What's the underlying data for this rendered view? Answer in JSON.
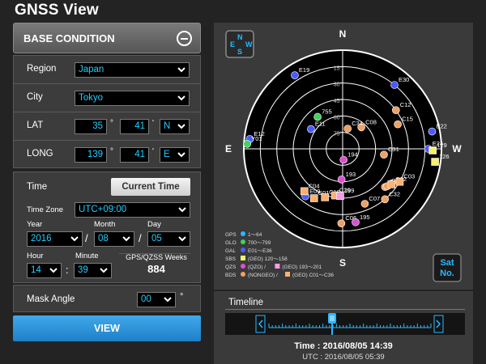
{
  "app": {
    "title": "GNSS View"
  },
  "base_condition": {
    "title": "BASE CONDITION",
    "region": {
      "label": "Region",
      "value": "Japan"
    },
    "city": {
      "label": "City",
      "value": "Tokyo"
    },
    "lat": {
      "label": "LAT",
      "deg": "35",
      "min": "41",
      "dir": "N"
    },
    "long": {
      "label": "LONG",
      "deg": "139",
      "min": "41",
      "dir": "E"
    },
    "deg_symbol": "°",
    "min_symbol": "'"
  },
  "time_section": {
    "label": "Time",
    "current_time_button": "Current Time",
    "timezone": {
      "label": "Time Zone",
      "value": "UTC+09:00"
    },
    "year": {
      "label": "Year",
      "value": "2016"
    },
    "month": {
      "label": "Month",
      "value": "08"
    },
    "day": {
      "label": "Day",
      "value": "05"
    },
    "hour": {
      "label": "Hour",
      "value": "14"
    },
    "minute": {
      "label": "Minute",
      "value": "39"
    },
    "separator_date": "/",
    "separator_time": ":",
    "weeks": {
      "label": "GPS/QZSS Weeks",
      "value": "884"
    }
  },
  "mask_angle": {
    "label": "Mask Angle",
    "value": "00",
    "unit": "°"
  },
  "view_button": "VIEW",
  "sky_plot": {
    "compass_labels": {
      "north": "N",
      "south": "S",
      "east": "E",
      "west": "W"
    },
    "compass_icon_letters": {
      "n": "N",
      "s": "S",
      "e": "E",
      "w": "W"
    },
    "sat_no_button": {
      "line1": "Sat",
      "line2": "No."
    },
    "elevation_labels": [
      "15°",
      "30°",
      "45°",
      "60°",
      "75°"
    ],
    "legend": [
      {
        "system": "GPS",
        "markers": [
          {
            "shape": "circle",
            "color": "#2bb7ff",
            "range": "1～64"
          }
        ]
      },
      {
        "system": "GLO",
        "markers": [
          {
            "shape": "circle",
            "color": "#3ed45a",
            "range": "700～799"
          }
        ]
      },
      {
        "system": "GAL",
        "markers": [
          {
            "shape": "circle",
            "color": "#4a5bff",
            "range": "E01～E36"
          }
        ]
      },
      {
        "system": "SBS",
        "markers": [
          {
            "shape": "square",
            "color": "#f8f070",
            "range": "(GEO) 120～158"
          }
        ]
      },
      {
        "system": "QZS",
        "markers": [
          {
            "shape": "circle",
            "color": "#e04ed6",
            "range": "(QZO) /"
          },
          {
            "shape": "square",
            "color": "#f59bea",
            "range": "(GEO) 193～201"
          }
        ]
      },
      {
        "system": "BDS",
        "markers": [
          {
            "shape": "circle",
            "color": "#f0a060",
            "range": "(NONGEO) /"
          },
          {
            "shape": "square",
            "color": "#ffb070",
            "range": "(GEO) C01～C36"
          }
        ]
      }
    ],
    "satellites": [
      {
        "label": "E19",
        "system": "GAL",
        "shape": "circle",
        "color": "#4a5bff",
        "elevation": 10,
        "azimuth": 327
      },
      {
        "label": "E30",
        "system": "GAL",
        "shape": "circle",
        "color": "#4a5bff",
        "elevation": 15,
        "azimuth": 39
      },
      {
        "label": "C12",
        "system": "BDS",
        "shape": "circle",
        "color": "#f0a060",
        "elevation": 30,
        "azimuth": 54
      },
      {
        "label": "C15",
        "system": "BDS",
        "shape": "circle",
        "color": "#f0a060",
        "elevation": 35,
        "azimuth": 66
      },
      {
        "label": "C08",
        "system": "BDS",
        "shape": "circle",
        "color": "#f0a060",
        "elevation": 64,
        "azimuth": 41
      },
      {
        "label": "C34",
        "system": "BDS",
        "shape": "circle",
        "color": "#f0a060",
        "elevation": 71,
        "azimuth": 14
      },
      {
        "label": "755",
        "system": "GLO",
        "shape": "circle",
        "color": "#3ed45a",
        "elevation": 53,
        "azimuth": 322
      },
      {
        "label": "E11",
        "system": "GAL",
        "shape": "circle",
        "color": "#4a5bff",
        "elevation": 56,
        "azimuth": 302
      },
      {
        "label": "E22",
        "system": "GAL",
        "shape": "circle",
        "color": "#4a5bff",
        "elevation": 7,
        "azimuth": 79
      },
      {
        "label": "E12",
        "system": "GAL",
        "shape": "circle",
        "color": "#4a5bff",
        "elevation": 5,
        "azimuth": 276
      },
      {
        "label": "Y01",
        "system": "GLO",
        "shape": "circle",
        "color": "#3ed45a",
        "elevation": 3,
        "azimuth": 273
      },
      {
        "label": "E24",
        "system": "GAL",
        "shape": "circle",
        "color": "#4a5bff",
        "elevation": 12,
        "azimuth": 90
      },
      {
        "label": "129",
        "system": "SBS",
        "shape": "square",
        "color": "#f8f070",
        "elevation": 8,
        "azimuth": 91
      },
      {
        "label": "126",
        "system": "SBS",
        "shape": "square",
        "color": "#f8f070",
        "elevation": 5,
        "azimuth": 98
      },
      {
        "label": "194",
        "system": "QZS",
        "shape": "circle",
        "color": "#e04ed6",
        "elevation": 80,
        "azimuth": 175
      },
      {
        "label": "C31",
        "system": "BDS",
        "shape": "circle",
        "color": "#f0a060",
        "elevation": 52,
        "azimuth": 98
      },
      {
        "label": "193",
        "system": "QZS",
        "shape": "circle",
        "color": "#e04ed6",
        "elevation": 62,
        "azimuth": 182
      },
      {
        "label": "C01",
        "system": "BDS",
        "shape": "square",
        "color": "#ffb070",
        "elevation": 38,
        "azimuth": 210
      },
      {
        "label": "E09",
        "system": "GAL",
        "shape": "circle",
        "color": "#4a5bff",
        "elevation": 35,
        "azimuth": 218
      },
      {
        "label": "C04",
        "system": "BDS",
        "shape": "square",
        "color": "#ffb070",
        "elevation": 38,
        "azimuth": 222
      },
      {
        "label": "C10",
        "system": "BDS",
        "shape": "square",
        "color": "#ffb070",
        "elevation": 43,
        "azimuth": 200
      },
      {
        "label": "C20",
        "system": "BDS",
        "shape": "square",
        "color": "#ffb070",
        "elevation": 47,
        "azimuth": 189
      },
      {
        "label": "199",
        "system": "QZS",
        "shape": "square",
        "color": "#f59bea",
        "elevation": 47,
        "azimuth": 183
      },
      {
        "label": "C13",
        "system": "BDS",
        "shape": "circle",
        "color": "#f0a060",
        "elevation": 38,
        "azimuth": 132
      },
      {
        "label": "C28",
        "system": "BDS",
        "shape": "circle",
        "color": "#f0a060",
        "elevation": 37,
        "azimuth": 130
      },
      {
        "label": "C02",
        "system": "BDS",
        "shape": "square",
        "color": "#ffb070",
        "elevation": 35,
        "azimuth": 126
      },
      {
        "label": "C03",
        "system": "BDS",
        "shape": "square",
        "color": "#ffb070",
        "elevation": 30,
        "azimuth": 120
      },
      {
        "label": "C32",
        "system": "BDS",
        "shape": "circle",
        "color": "#f0a060",
        "elevation": 30,
        "azimuth": 140
      },
      {
        "label": "C07",
        "system": "BDS",
        "shape": "circle",
        "color": "#f0a060",
        "elevation": 36,
        "azimuth": 158
      },
      {
        "label": "C06",
        "system": "BDS",
        "shape": "circle",
        "color": "#f0a060",
        "elevation": 22,
        "azimuth": 181
      },
      {
        "label": "195",
        "system": "QZS",
        "shape": "circle",
        "color": "#e04ed6",
        "elevation": 22,
        "azimuth": 170
      }
    ]
  },
  "timeline": {
    "title": "Timeline",
    "position": 0.39,
    "time_text": "Time :  2016/08/05 14:39",
    "utc_text": "UTC :  2016/08/05 05:39"
  }
}
